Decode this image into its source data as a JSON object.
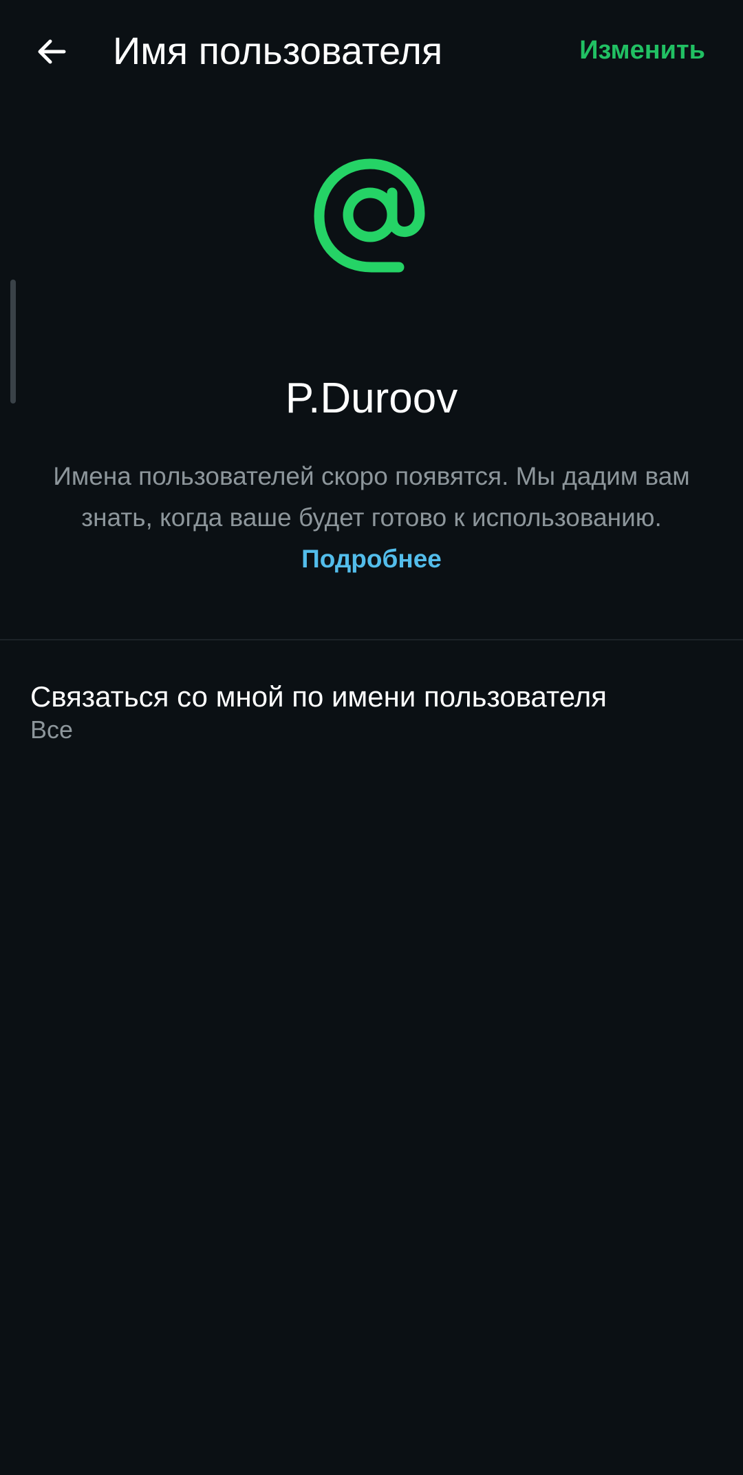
{
  "header": {
    "back_icon": "arrow-left-icon",
    "title": "Имя пользователя",
    "edit_label": "Изменить"
  },
  "profile": {
    "icon": "at-sign-icon",
    "username": "P.Duroov",
    "description": "Имена пользователей скоро появятся. Мы дадим вам знать, когда ваше будет готово к использованию.",
    "learn_more": "Подробнее"
  },
  "settings": {
    "contact_by_username": {
      "title": "Связаться со мной по имени пользователя",
      "value": "Все"
    }
  },
  "colors": {
    "background": "#0b1014",
    "accent_green": "#21c063",
    "link_blue": "#53bdeb",
    "secondary_text": "#8d969b",
    "primary_text": "#ffffff"
  }
}
